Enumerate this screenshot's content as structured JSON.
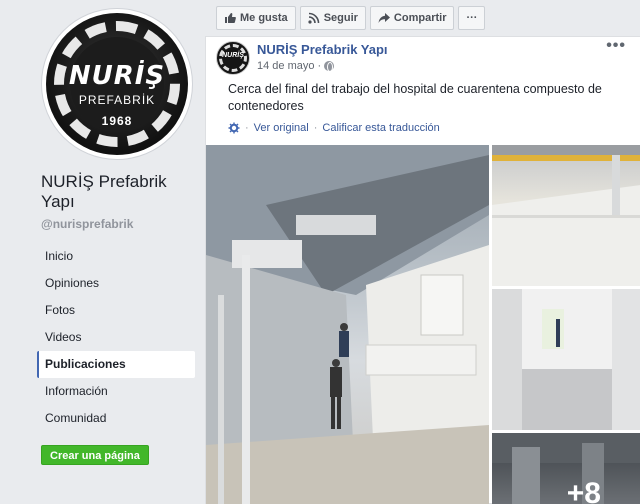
{
  "sidebar": {
    "logo": {
      "brand": "NURİŞ",
      "sub": "PREFABRİK",
      "year": "1968"
    },
    "page_name": "NURİŞ Prefabrik Yapı",
    "handle": "@nurisprefabrik",
    "nav": [
      {
        "label": "Inicio",
        "active": false
      },
      {
        "label": "Opiniones",
        "active": false
      },
      {
        "label": "Fotos",
        "active": false
      },
      {
        "label": "Videos",
        "active": false
      },
      {
        "label": "Publicaciones",
        "active": true
      },
      {
        "label": "Información",
        "active": false
      },
      {
        "label": "Comunidad",
        "active": false
      }
    ],
    "create_page_label": "Crear una página"
  },
  "actions": {
    "like_label": "Me gusta",
    "follow_label": "Seguir",
    "share_label": "Compartir",
    "more_label": "···"
  },
  "post": {
    "author": "NURİŞ Prefabrik Yapı",
    "date": "14 de mayo",
    "separator": "·",
    "more": "•••",
    "avatar_text": "NURİŞ",
    "text": "Cerca del final del trabajo del hospital de cuarentena compuesto de contenedores",
    "see_original": "Ver original",
    "rate_translation": "Calificar esta traducción",
    "translation_separator": "·",
    "more_photos": "+8"
  },
  "colors": {
    "link": "#385898",
    "accent": "#4267b2",
    "create_button": "#42b72a",
    "background": "#e9ebee"
  }
}
